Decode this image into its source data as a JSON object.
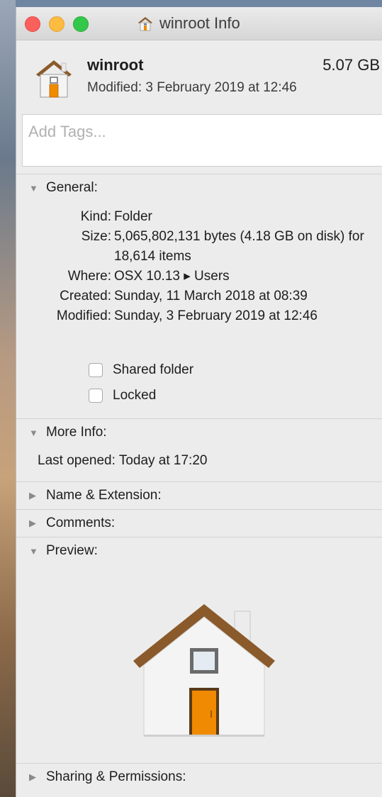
{
  "window": {
    "title": "winroot Info",
    "traffic_lights": {
      "close": "#fc605c",
      "minimize": "#fdbc40",
      "zoom": "#34c84a"
    }
  },
  "header": {
    "name": "winroot",
    "size": "5.07 GB",
    "modified": "Modified: 3 February 2019 at 12:46"
  },
  "tags": {
    "placeholder": "Add Tags..."
  },
  "general": {
    "title": "General:",
    "rows": [
      {
        "label": "Kind:",
        "value": "Folder"
      },
      {
        "label": "Size:",
        "value": "5,065,802,131 bytes (4.18 GB on disk) for 18,614 items"
      },
      {
        "label": "Where:",
        "value": "OSX 10.13 ▸ Users"
      },
      {
        "label": "Created:",
        "value": "Sunday, 11 March 2018 at 08:39"
      },
      {
        "label": "Modified:",
        "value": "Sunday, 3 February 2019 at 12:46"
      }
    ],
    "shared_folder": "Shared folder",
    "locked": "Locked"
  },
  "more_info": {
    "title": "More Info:",
    "last_opened_label": "Last opened:",
    "last_opened_value": "Today at 17:20"
  },
  "sections": {
    "name_extension": "Name & Extension:",
    "comments": "Comments:",
    "preview": "Preview:",
    "sharing": "Sharing & Permissions:"
  },
  "icons": {
    "folder_icon": "home-folder-icon",
    "expanded": "disclosure-triangle-down-icon",
    "collapsed": "disclosure-triangle-right-icon"
  },
  "colors": {
    "roof": "#8a5a2b",
    "door": "#f08a00",
    "walls": "#f2f2f2"
  }
}
